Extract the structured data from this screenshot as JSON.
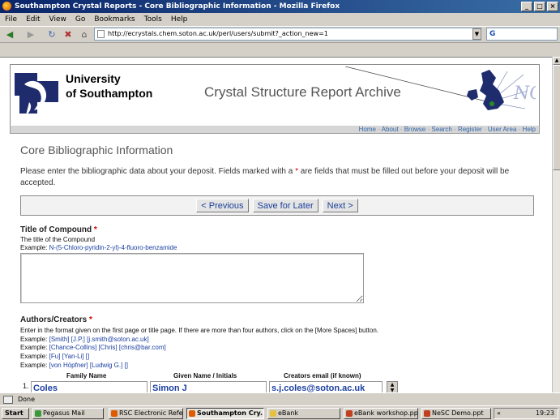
{
  "window": {
    "title": "Southampton Crystal Reports - Core Bibliographic Information - Mozilla Firefox",
    "buttons": [
      "_",
      "□",
      "×"
    ]
  },
  "menu": [
    "File",
    "Edit",
    "View",
    "Go",
    "Bookmarks",
    "Tools",
    "Help"
  ],
  "nav": {
    "back_icon": "back-arrow-icon",
    "url": "http://ecrystals.chem.soton.ac.uk/perl/users/submit?_action_new=1",
    "search_value": "G"
  },
  "banner": {
    "uni_line1": "University",
    "uni_line2": "of Southampton",
    "title": "Crystal Structure Report Archive",
    "logo_text": "NCS"
  },
  "links": [
    "Home",
    "About",
    "Browse",
    "Search",
    "Register",
    "User Area",
    "Help"
  ],
  "page": {
    "heading": "Core Bibliographic Information",
    "intro_a": "Please enter the bibliographic data about your deposit. Fields marked with a ",
    "intro_star": "*",
    "intro_b": " are fields that must be filled out before your deposit will be accepted."
  },
  "buttons": {
    "previous": "< Previous",
    "save": "Save for Later",
    "next": "Next >"
  },
  "title_section": {
    "label": "Title of Compound",
    "star": "*",
    "help": "The title of the Compound",
    "example_label": "Example:",
    "example": "N-(5-Chloro-pyridin-2-yl)-4-fluoro-benzamide",
    "value": ""
  },
  "authors_section": {
    "label": "Authors/Creators",
    "star": "*",
    "help": "Enter in the format given on the first page or title page. If there are more than four authors, click on the [More Spaces] button.",
    "examples": [
      {
        "label": "Example:",
        "text": "[Smith] [J.P.] [j.smith@soton.ac.uk]"
      },
      {
        "label": "Example:",
        "text": "[Chance-Collins] [Chris] [chris@bar.com]"
      },
      {
        "label": "Example:",
        "text": "[Fu] [Yan-Li] []"
      },
      {
        "label": "Example:",
        "text": "[von Höpfner] [Ludwig G.] []"
      }
    ],
    "headers": {
      "family": "Family Name",
      "given": "Given Name / Initials",
      "email": "Creators email (if known)"
    },
    "row_number": "1.",
    "row": {
      "family": "Coles",
      "given": "Simon J",
      "email": "s.j.coles@soton.ac.uk"
    }
  },
  "status": {
    "text": "Done"
  },
  "taskbar": {
    "start": "Start",
    "tasks": [
      "Pegasus Mail",
      "RSC Electronic Refe...",
      "Southampton Cry...",
      "eBank",
      "eBank workshop.ppt",
      "NeSC Demo.ppt"
    ],
    "clock": "19:23",
    "tray_prefix": "«"
  },
  "colors": {
    "title_bar": "#0a246a",
    "link_blue": "#3366aa",
    "required_red": "#cc0000",
    "button_text": "#1a3f9a"
  }
}
